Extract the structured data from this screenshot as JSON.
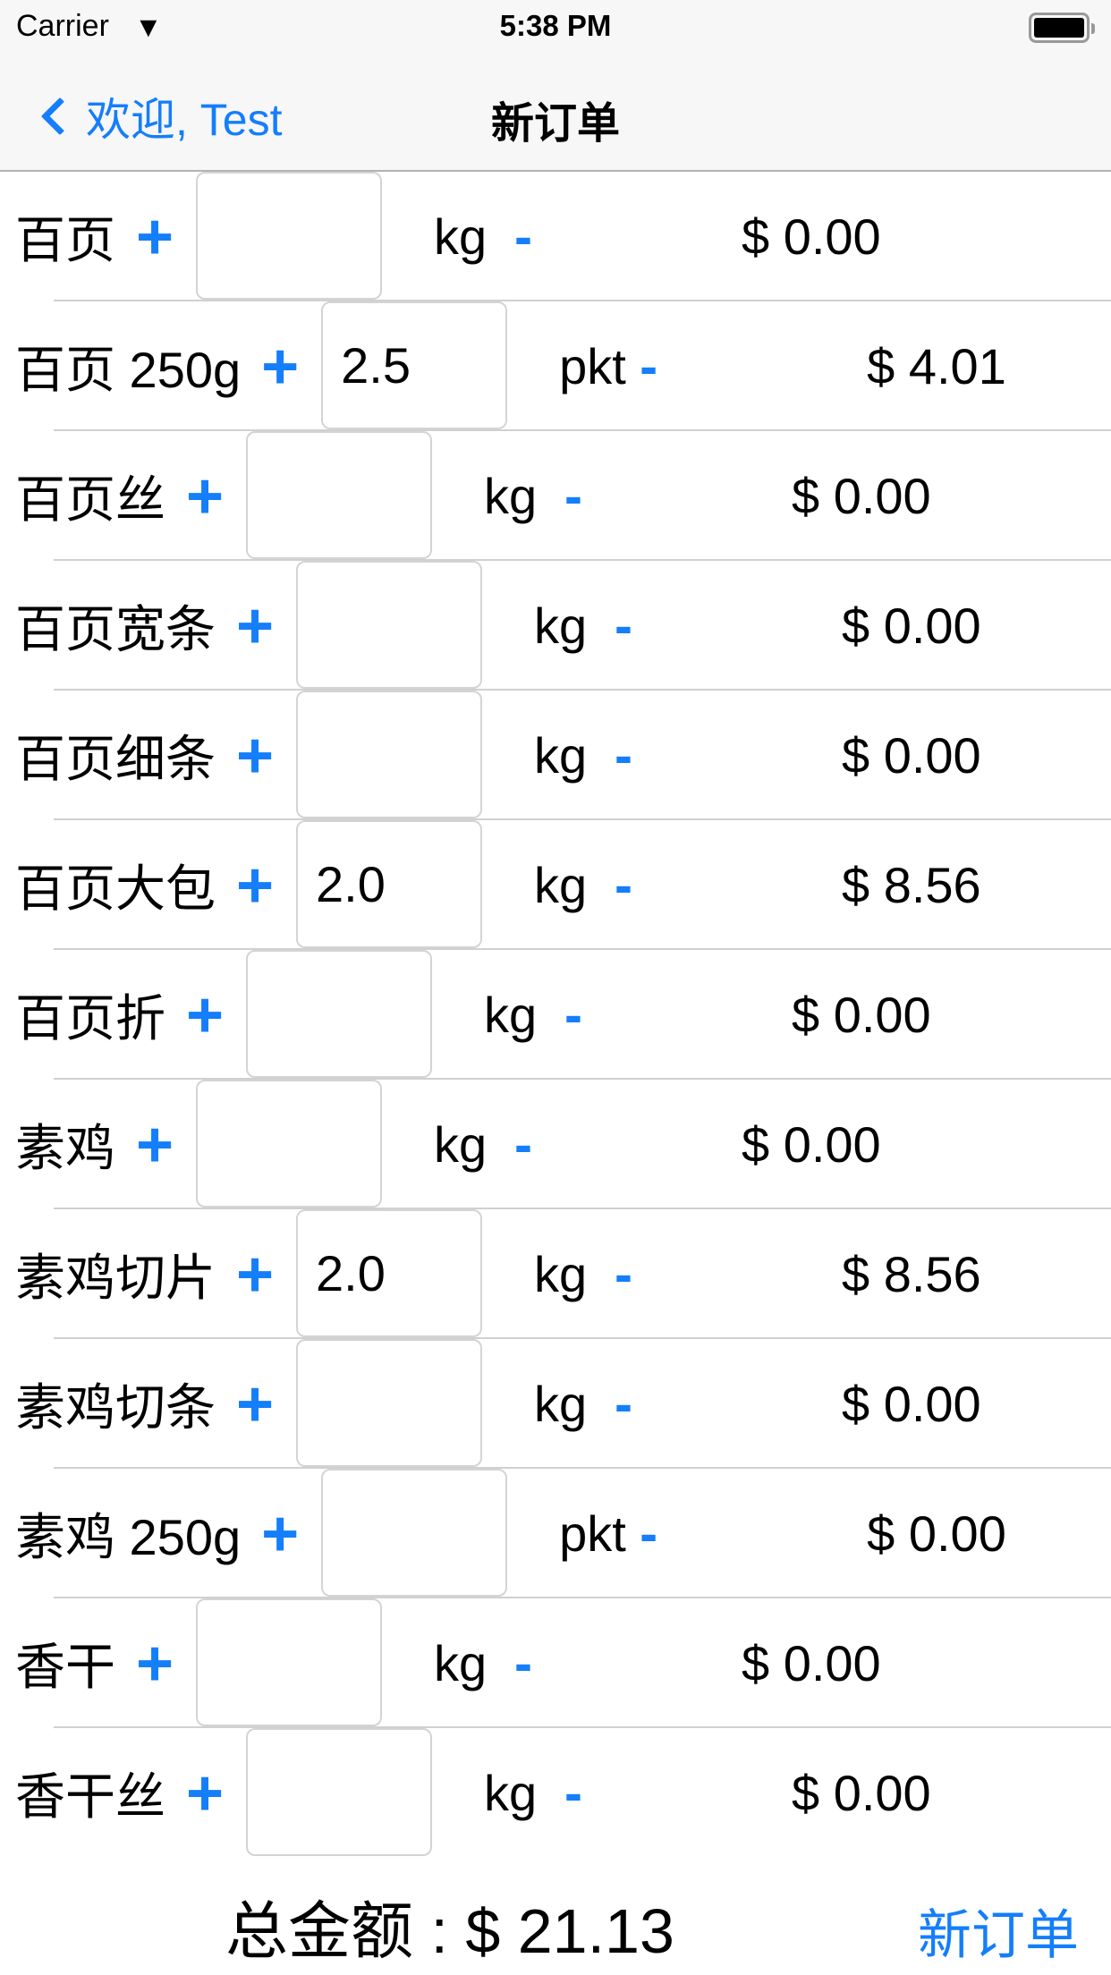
{
  "status": {
    "carrier": "Carrier",
    "time": "5:38 PM"
  },
  "nav": {
    "back_label": "欢迎, Test",
    "title": "新订单"
  },
  "items": [
    {
      "name": "百页",
      "qty": "",
      "unit": "kg",
      "price": "$ 0.00"
    },
    {
      "name": "百页 250g",
      "qty": "2.5",
      "unit": "pkt",
      "price": "$ 4.01"
    },
    {
      "name": "百页丝",
      "qty": "",
      "unit": "kg",
      "price": "$ 0.00"
    },
    {
      "name": "百页宽条",
      "qty": "",
      "unit": "kg",
      "price": "$ 0.00"
    },
    {
      "name": "百页细条",
      "qty": "",
      "unit": "kg",
      "price": "$ 0.00"
    },
    {
      "name": "百页大包",
      "qty": "2.0",
      "unit": "kg",
      "price": "$ 8.56"
    },
    {
      "name": "百页折",
      "qty": "",
      "unit": "kg",
      "price": "$ 0.00"
    },
    {
      "name": "素鸡",
      "qty": "",
      "unit": "kg",
      "price": "$ 0.00"
    },
    {
      "name": "素鸡切片",
      "qty": "2.0",
      "unit": "kg",
      "price": "$ 8.56"
    },
    {
      "name": "素鸡切条",
      "qty": "",
      "unit": "kg",
      "price": "$ 0.00"
    },
    {
      "name": "素鸡 250g",
      "qty": "",
      "unit": "pkt",
      "price": "$ 0.00"
    },
    {
      "name": "香干",
      "qty": "",
      "unit": "kg",
      "price": "$ 0.00"
    },
    {
      "name": "香干丝",
      "qty": "",
      "unit": "kg",
      "price": "$ 0.00"
    }
  ],
  "controls": {
    "plus": "+",
    "minus": "-"
  },
  "footer": {
    "total": "总金额 : $ 21.13",
    "new_order": "新订单"
  }
}
